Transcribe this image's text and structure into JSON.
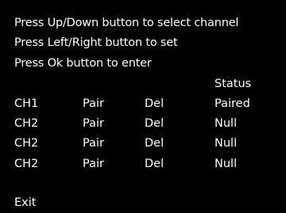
{
  "instructions": [
    "Press Up/Down button to select channel",
    "Press Left/Right button to set",
    "Press Ok button to enter"
  ],
  "table": {
    "status_header": "Status",
    "rows": [
      {
        "channel": "CH1",
        "pair": "Pair",
        "del": "Del",
        "status": "Paired"
      },
      {
        "channel": "CH2",
        "pair": "Pair",
        "del": "Del",
        "status": "Null"
      },
      {
        "channel": "CH2",
        "pair": "Pair",
        "del": "Del",
        "status": "Null"
      },
      {
        "channel": "CH2",
        "pair": "Pair",
        "del": "Del",
        "status": "Null"
      }
    ]
  },
  "exit_label": "Exit",
  "colors": {
    "background": "#000000",
    "text": "#ffffff"
  }
}
